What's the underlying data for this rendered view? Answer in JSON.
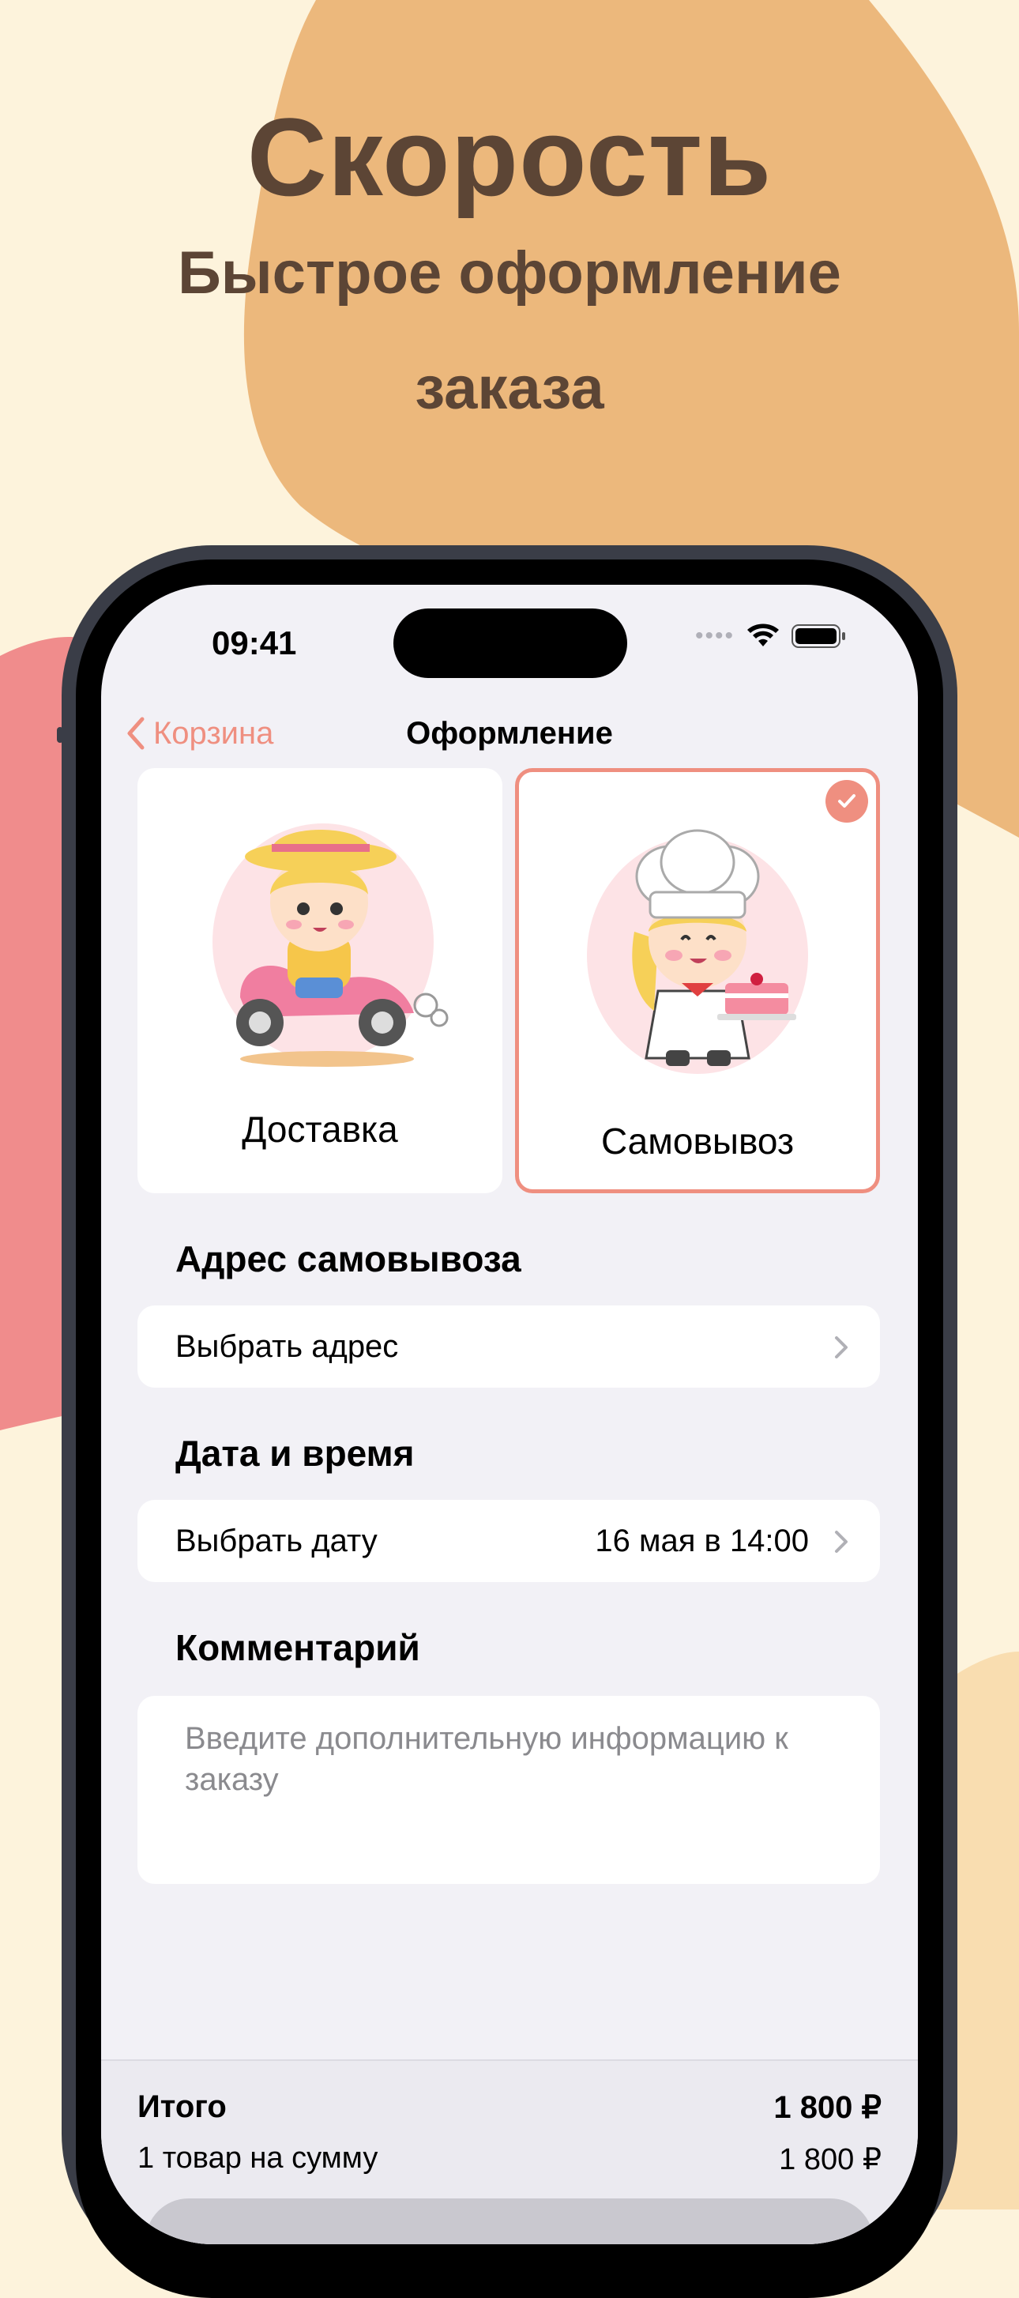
{
  "colors": {
    "background": "#fdf3dc",
    "blob_orange": "#ecb87c",
    "blob_pink": "#f08c8c",
    "accent": "#ef8f80",
    "headline": "#5c4535"
  },
  "headline": {
    "title": "Скорость",
    "subtitle_line1": "Быстрое оформление",
    "subtitle_line2": "заказа"
  },
  "status_bar": {
    "time": "09:41"
  },
  "nav": {
    "back_label": "Корзина",
    "title": "Оформление"
  },
  "options": [
    {
      "label": "Доставка",
      "selected": false
    },
    {
      "label": "Самовывоз",
      "selected": true
    }
  ],
  "pickup_address": {
    "title": "Адрес самовывоза",
    "row_label": "Выбрать адрес"
  },
  "datetime": {
    "title": "Дата и время",
    "row_label": "Выбрать дату",
    "value": "16 мая в 14:00"
  },
  "comment": {
    "title": "Комментарий",
    "placeholder": "Введите дополнительную информацию к заказу"
  },
  "summary": {
    "total_label": "Итого",
    "total_value": "1 800 ₽",
    "items_label": "1 товар на сумму",
    "items_value": "1 800 ₽"
  }
}
